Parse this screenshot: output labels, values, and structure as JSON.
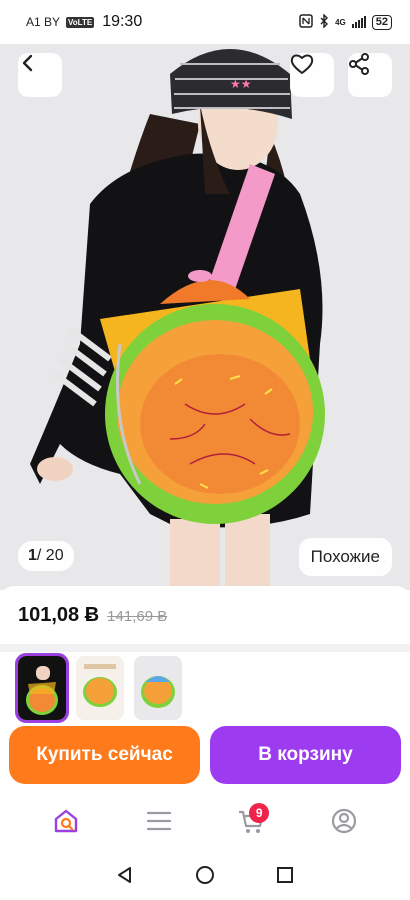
{
  "status_bar": {
    "carrier": "A1 BY",
    "volte": "VoLTE",
    "time": "19:30",
    "network": "4G",
    "battery": "52"
  },
  "gallery": {
    "current": "1",
    "total": "/ 20",
    "similar_label": "Похожие"
  },
  "price": {
    "current": "101,08 Ƀ",
    "old": "141,69 Ƀ"
  },
  "actions": {
    "buy_now": "Купить сейчас",
    "add_to_cart": "В корзину"
  },
  "nav": {
    "cart_count": "9"
  },
  "colors": {
    "buy_button": "#ff7a1a",
    "cart_button": "#9c3bf0",
    "badge": "#f0234b",
    "accent": "#9b3fe0"
  },
  "icons": [
    "back-icon",
    "heart-icon",
    "share-icon",
    "home-search-icon",
    "menu-icon",
    "cart-icon",
    "profile-icon"
  ]
}
